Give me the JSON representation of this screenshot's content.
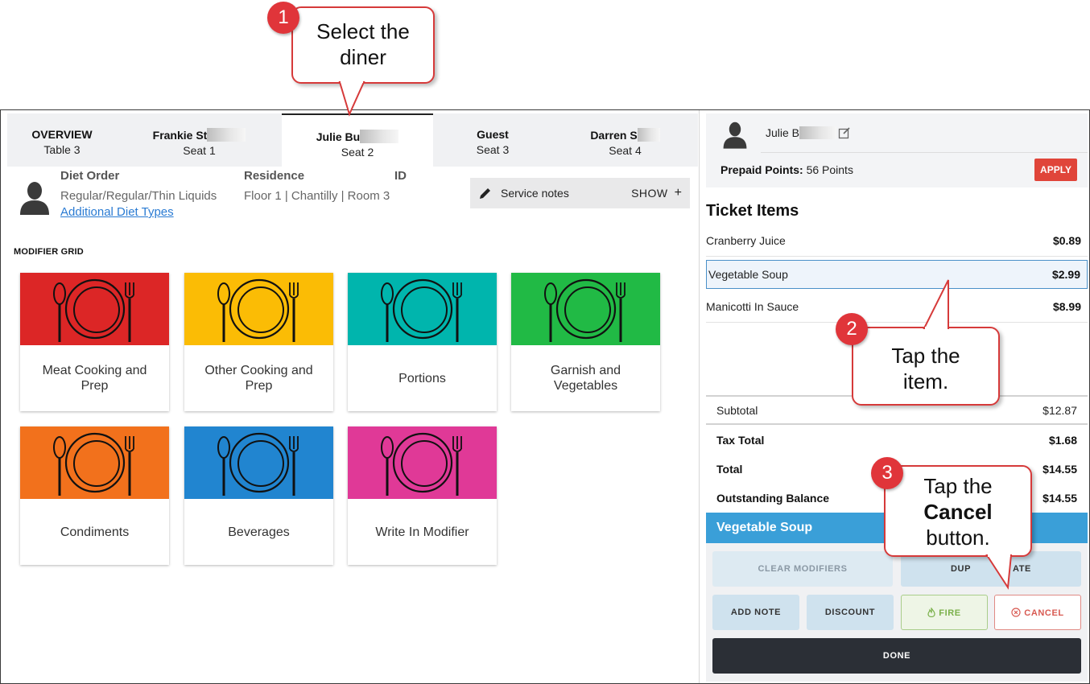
{
  "tabs": [
    {
      "name": "OVERVIEW",
      "sub": "Table 3",
      "redacted": false,
      "active": false
    },
    {
      "name": "Frankie St",
      "sub": "Seat 1",
      "redacted": true,
      "active": false
    },
    {
      "name": "Julie Bu",
      "sub": "Seat 2",
      "redacted": true,
      "active": true
    },
    {
      "name": "Guest",
      "sub": "Seat 3",
      "redacted": false,
      "active": false
    },
    {
      "name": "Darren S",
      "sub": "Seat 4",
      "redacted": true,
      "active": false
    }
  ],
  "diner": {
    "diet_order_label": "Diet Order",
    "diet_order_value": "Regular/Regular/Thin Liquids",
    "additional_diet_link": "Additional Diet Types",
    "residence_label": "Residence",
    "residence_value": "Floor 1 | Chantilly | Room 3",
    "id_label": "ID"
  },
  "service_notes": {
    "label": "Service notes",
    "show": "SHOW",
    "plus": "+"
  },
  "modifier_grid": {
    "title": "MODIFIER GRID",
    "items": [
      {
        "label": "Meat Cooking and Prep",
        "color": "#dc2626"
      },
      {
        "label": "Other Cooking and Prep",
        "color": "#fbbc05"
      },
      {
        "label": "Portions",
        "color": "#00b5ad"
      },
      {
        "label": "Garnish and Vegetables",
        "color": "#21ba45"
      },
      {
        "label": "Condiments",
        "color": "#f2711c"
      },
      {
        "label": "Beverages",
        "color": "#2185d0"
      },
      {
        "label": "Write In Modifier",
        "color": "#e03997"
      }
    ]
  },
  "right_panel": {
    "diner_name": "Julie B",
    "prepaid_label": "Prepaid Points:",
    "prepaid_value": "56 Points",
    "apply": "APPLY",
    "ticket_title": "Ticket Items",
    "items": [
      {
        "name": "Cranberry Juice",
        "price": "$0.89",
        "selected": false
      },
      {
        "name": "Vegetable Soup",
        "price": "$2.99",
        "selected": true
      },
      {
        "name": "Manicotti In Sauce",
        "price": "$8.99",
        "selected": false
      }
    ],
    "subtotal_label": "Subtotal",
    "subtotal": "$12.87",
    "tax_label": "Tax Total",
    "tax": "$1.68",
    "total_label": "Total",
    "total": "$14.55",
    "balance_label": "Outstanding Balance",
    "balance": "$14.55",
    "selected_item": "Vegetable Soup",
    "buttons": {
      "clear_modifiers": "CLEAR MODIFIERS",
      "duplicate_visible": "DUP",
      "duplicate_visible_end": "ATE",
      "add_note": "ADD NOTE",
      "discount": "DISCOUNT",
      "fire": "FIRE",
      "cancel": "CANCEL",
      "done": "DONE"
    }
  },
  "callouts": [
    {
      "number": "1",
      "line1": "Select the",
      "line2": "diner"
    },
    {
      "number": "2",
      "line1": "Tap the",
      "line2": "item."
    },
    {
      "number": "3",
      "line1": "Tap the",
      "line2_bold": "Cancel",
      "line3": "button."
    }
  ],
  "colors": {
    "accent_red": "#e0353a",
    "selected_bar": "#3a9fd8",
    "apply": "#e0453a"
  }
}
